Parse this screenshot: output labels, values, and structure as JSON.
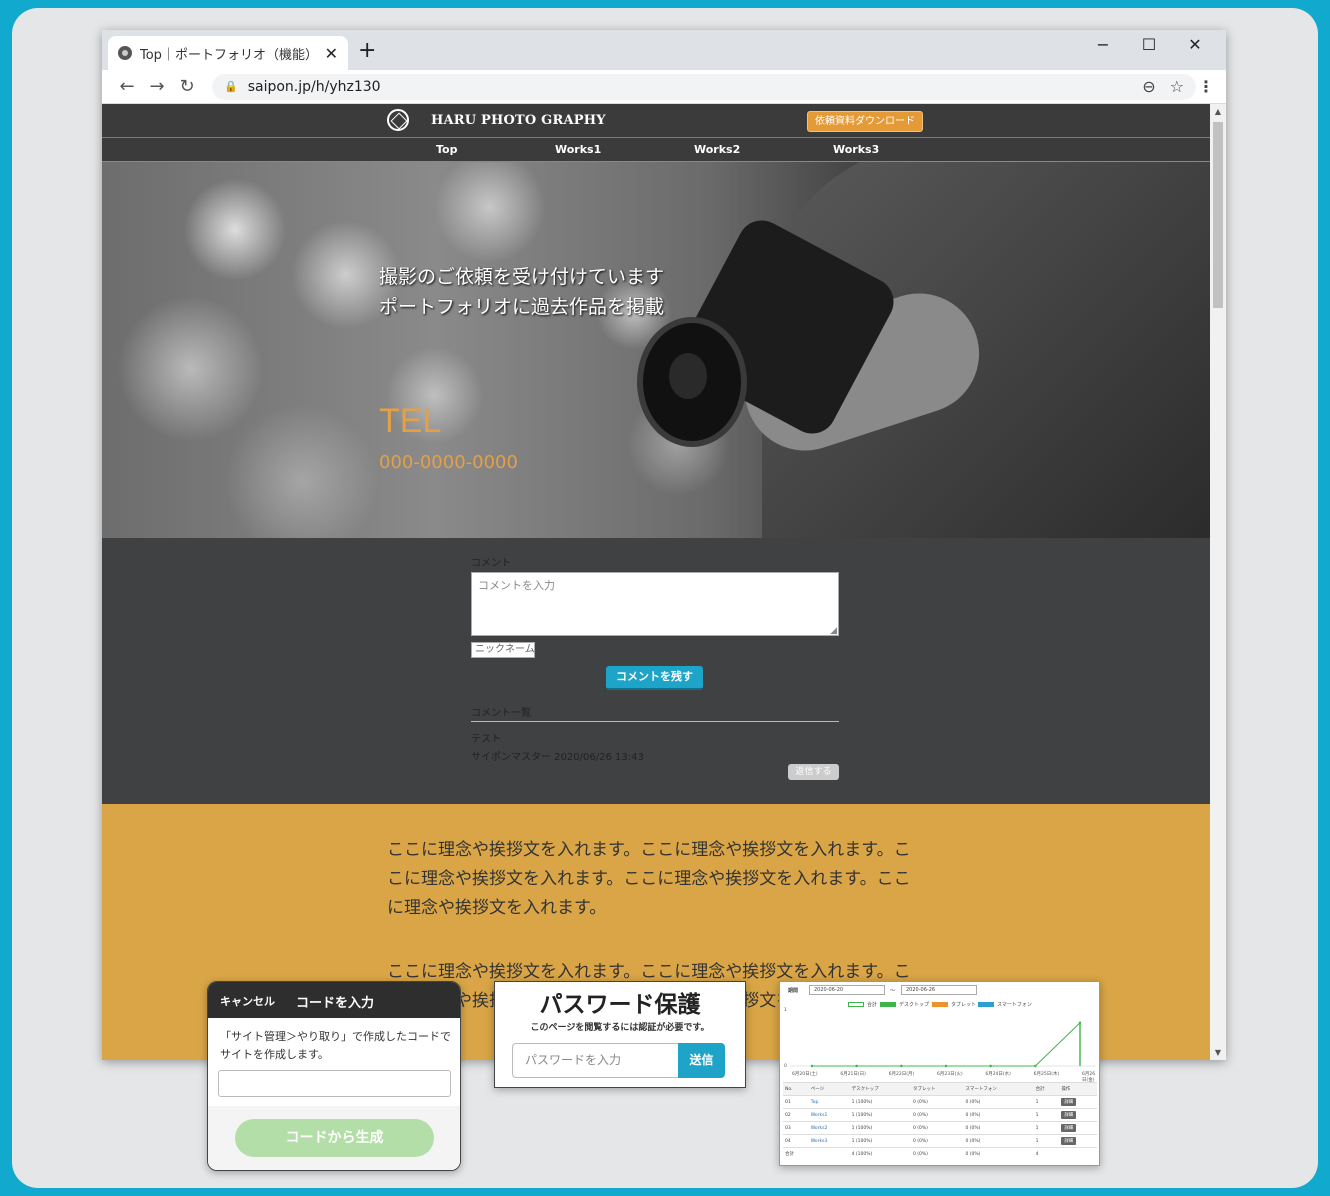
{
  "browser": {
    "tab_title": "Top｜ポートフォリオ（機能）",
    "url": "saipon.jp/h/yhz130"
  },
  "site": {
    "brand": "HARU PHOTO GRAPHY",
    "download_button": "依頼資料ダウンロード",
    "nav": [
      "Top",
      "Works1",
      "Works2",
      "Works3"
    ],
    "hero_line1": "撮影のご依頼を受け付けています",
    "hero_line2": "ポートフォリオに過去作品を掲載",
    "tel_label": "TEL",
    "tel_number": "000-0000-0000",
    "comment": {
      "label": "コメント",
      "placeholder": "コメントを入力",
      "nickname_placeholder": "ニックネーム",
      "submit": "コメントを残す",
      "list_heading": "コメント一覧",
      "entry_text": "テスト",
      "entry_meta": "サイポンマスター 2020/06/26 13:43",
      "reply": "返信する"
    },
    "about_p1": "ここに理念や挨拶文を入れます。ここに理念や挨拶文を入れます。ここに理念や挨拶文を入れます。ここに理念や挨拶文を入れます。ここに理念や挨拶文を入れます。",
    "about_p2": "ここに理念や挨拶文を入れます。ここに理念や挨拶文を入れます。ここに理念や挨拶文を入れます。ここに理念や挨拶文を入れます。"
  },
  "code_modal": {
    "cancel": "キャンセル",
    "title": "コードを入力",
    "description": "「サイト管理＞やり取り」で作成したコードでサイトを作成します。",
    "generate": "コードから生成"
  },
  "password_box": {
    "title": "パスワード保護",
    "subtitle": "このページを閲覧するには認証が必要です。",
    "placeholder": "パスワードを入力",
    "submit": "送信"
  },
  "stats": {
    "period_label": "期間",
    "date_from": "2020-06-20",
    "date_to": "2020-06-26",
    "tilde": "〜",
    "legend": [
      {
        "name": "合計",
        "color": "#ffffff"
      },
      {
        "name": "デスクトップ",
        "color": "#3cb54a"
      },
      {
        "name": "タブレット",
        "color": "#f0922c"
      },
      {
        "name": "スマートフォン",
        "color": "#2a9fd0"
      }
    ],
    "y_ticks": [
      "1",
      "0"
    ],
    "x_labels": [
      "6月20日(土)",
      "6月21日(日)",
      "6月22日(月)",
      "6月23日(火)",
      "6月24日(水)",
      "6月25日(木)",
      "6月26日(金)"
    ],
    "chart_data": {
      "type": "line",
      "categories": [
        "6月20日(土)",
        "6月21日(日)",
        "6月22日(月)",
        "6月23日(火)",
        "6月24日(水)",
        "6月25日(木)",
        "6月26日(金)"
      ],
      "series": [
        {
          "name": "合計",
          "values": [
            0,
            0,
            0,
            0,
            0,
            0,
            4
          ]
        },
        {
          "name": "デスクトップ",
          "values": [
            0,
            0,
            0,
            0,
            0,
            0,
            4
          ]
        }
      ],
      "ylim": [
        0,
        5
      ]
    },
    "table": {
      "headers": [
        "No.",
        "ページ",
        "デスクトップ",
        "タブレット",
        "スマートフォン",
        "合計",
        "操作"
      ],
      "rows": [
        [
          "01",
          "Top",
          "1 (100%)",
          "0 (0%)",
          "0 (0%)",
          "1",
          "詳細"
        ],
        [
          "02",
          "Works1",
          "1 (100%)",
          "0 (0%)",
          "0 (0%)",
          "1",
          "詳細"
        ],
        [
          "03",
          "Works2",
          "1 (100%)",
          "0 (0%)",
          "0 (0%)",
          "1",
          "詳細"
        ],
        [
          "04",
          "Works3",
          "1 (100%)",
          "0 (0%)",
          "0 (0%)",
          "1",
          "詳細"
        ]
      ],
      "total_row": [
        "合計",
        "",
        "4 (100%)",
        "0 (0%)",
        "0 (0%)",
        "4",
        ""
      ]
    }
  }
}
